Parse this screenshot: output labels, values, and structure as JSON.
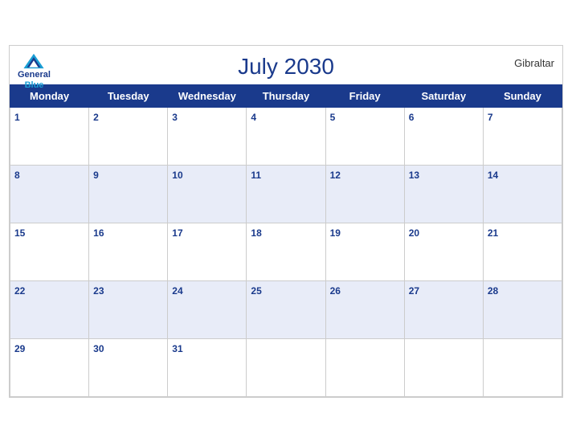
{
  "header": {
    "title": "July 2030",
    "location": "Gibraltar",
    "logo": {
      "line1": "General",
      "line2": "Blue"
    }
  },
  "weekdays": [
    "Monday",
    "Tuesday",
    "Wednesday",
    "Thursday",
    "Friday",
    "Saturday",
    "Sunday"
  ],
  "weeks": [
    [
      {
        "day": 1
      },
      {
        "day": 2
      },
      {
        "day": 3
      },
      {
        "day": 4
      },
      {
        "day": 5
      },
      {
        "day": 6
      },
      {
        "day": 7
      }
    ],
    [
      {
        "day": 8
      },
      {
        "day": 9
      },
      {
        "day": 10
      },
      {
        "day": 11
      },
      {
        "day": 12
      },
      {
        "day": 13
      },
      {
        "day": 14
      }
    ],
    [
      {
        "day": 15
      },
      {
        "day": 16
      },
      {
        "day": 17
      },
      {
        "day": 18
      },
      {
        "day": 19
      },
      {
        "day": 20
      },
      {
        "day": 21
      }
    ],
    [
      {
        "day": 22
      },
      {
        "day": 23
      },
      {
        "day": 24
      },
      {
        "day": 25
      },
      {
        "day": 26
      },
      {
        "day": 27
      },
      {
        "day": 28
      }
    ],
    [
      {
        "day": 29
      },
      {
        "day": 30
      },
      {
        "day": 31
      },
      {
        "day": null
      },
      {
        "day": null
      },
      {
        "day": null
      },
      {
        "day": null
      }
    ]
  ]
}
